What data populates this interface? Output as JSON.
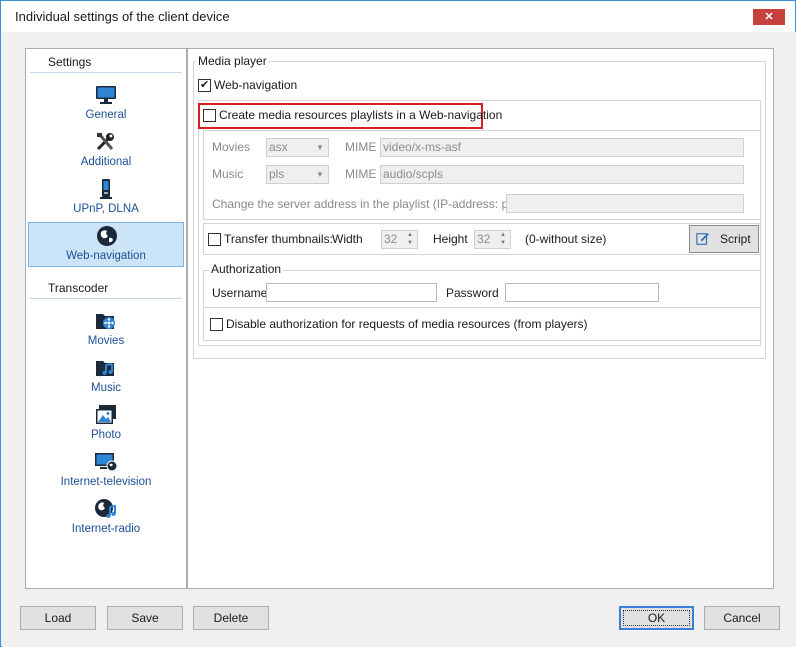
{
  "window": {
    "title": "Individual settings of the client device",
    "close_label": "✕"
  },
  "nav": {
    "settings_header": "Settings",
    "transcoder_header": "Transcoder",
    "settings_items": [
      {
        "label": "General",
        "icon": "monitor-icon"
      },
      {
        "label": "Additional",
        "icon": "tools-icon"
      },
      {
        "label": "UPnP, DLNA",
        "icon": "device-icon"
      },
      {
        "label": "Web-navigation",
        "icon": "globe-icon",
        "active": true
      }
    ],
    "transcoder_items": [
      {
        "label": "Movies",
        "icon": "film-folder-icon"
      },
      {
        "label": "Music",
        "icon": "music-folder-icon"
      },
      {
        "label": "Photo",
        "icon": "photo-icon"
      },
      {
        "label": "Internet-television",
        "icon": "tv-globe-icon"
      },
      {
        "label": "Internet-radio",
        "icon": "radio-globe-icon"
      }
    ]
  },
  "media_player": {
    "group_title": "Media player",
    "web_navigation_label": "Web-navigation",
    "web_navigation_checked": true,
    "create_playlists_label": "Create media resources playlists  in a Web-navigation",
    "create_playlists_checked": false,
    "movies_label": "Movies",
    "movies_format": "asx",
    "mime_label": "MIME",
    "movies_mime": "video/x-ms-asf",
    "music_label": "Music",
    "music_format": "pls",
    "music_mime": "audio/scpls",
    "server_address_label": "Change the server address in the playlist (IP-address: port)",
    "server_address_value": "",
    "transfer_thumbnails_label": "Transfer thumbnails:",
    "transfer_thumbnails_checked": false,
    "width_label": "Width",
    "width_value": "32",
    "height_label": "Height",
    "height_value": "32",
    "without_size_note": "(0-without size)",
    "script_button": "Script"
  },
  "authorization": {
    "group_title": "Authorization",
    "username_label": "Username",
    "username_value": "",
    "password_label": "Password",
    "password_value": "",
    "disable_auth_label": "Disable authorization for requests of media resources (from players)",
    "disable_auth_checked": false
  },
  "footer": {
    "load": "Load",
    "save": "Save",
    "delete": "Delete",
    "ok": "OK",
    "cancel": "Cancel"
  },
  "colors": {
    "highlight": "#e01b24",
    "nav_text": "#1c4f95",
    "active_bg": "#cce4f7"
  }
}
